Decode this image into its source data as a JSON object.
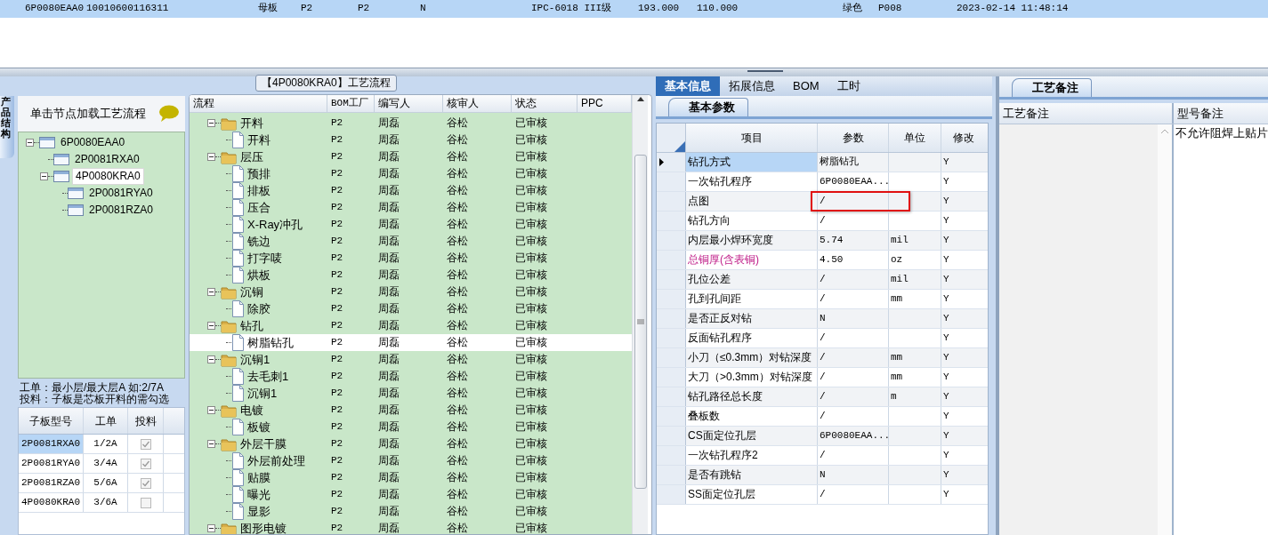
{
  "top_row": {
    "selected": true,
    "cells": [
      "6P0080EAA0",
      "10010600116311",
      "母板",
      "P2",
      "P2",
      "N",
      "IPC-6018 III级",
      "193.000",
      "110.000",
      "绿色",
      "P008",
      "2023-02-14 11:48:14"
    ]
  },
  "left_panel": {
    "side_tab": "产品结构",
    "header": "单击节点加载工艺流程",
    "tree": [
      {
        "label": "6P0080EAA0",
        "expanded": true,
        "selected": false,
        "children": [
          {
            "label": "2P0081RXA0",
            "selected": false
          },
          {
            "label": "4P0080KRA0",
            "expanded": true,
            "selected": true,
            "children": [
              {
                "label": "2P0081RYA0",
                "selected": false
              },
              {
                "label": "2P0081RZA0",
                "selected": false
              }
            ]
          }
        ]
      }
    ],
    "notes": [
      "工单：最小层/最大层A 如:2/7A",
      "投料：子板是芯板开料的需勾选"
    ],
    "table": {
      "columns": [
        "子板型号",
        "工单",
        "投料"
      ],
      "rows": [
        {
          "model": "2P0081RXA0",
          "order": "1/2A",
          "feed": true,
          "selected": true
        },
        {
          "model": "2P0081RYA0",
          "order": "3/4A",
          "feed": true,
          "selected": false
        },
        {
          "model": "2P0081RZA0",
          "order": "5/6A",
          "feed": true,
          "selected": false
        },
        {
          "model": "4P0080KRA0",
          "order": "3/6A",
          "feed": false,
          "selected": false
        }
      ]
    }
  },
  "flow_panel": {
    "title": "【4P0080KRA0】工艺流程",
    "columns": [
      "流程",
      "BOM工厂",
      "编写人",
      "核审人",
      "状态",
      "PPC"
    ],
    "rows": [
      {
        "kind": "folder",
        "name": "开料",
        "factory": "P2",
        "writer": "周磊",
        "reviewer": "谷松",
        "status": "已审核",
        "expanded": true,
        "selected": false,
        "children": [
          {
            "kind": "file",
            "name": "开料",
            "factory": "P2",
            "writer": "周磊",
            "reviewer": "谷松",
            "status": "已审核",
            "selected": false
          }
        ]
      },
      {
        "kind": "folder",
        "name": "层压",
        "factory": "P2",
        "writer": "周磊",
        "reviewer": "谷松",
        "status": "已审核",
        "expanded": true,
        "selected": false,
        "children": [
          {
            "kind": "file",
            "name": "预排",
            "factory": "P2",
            "writer": "周磊",
            "reviewer": "谷松",
            "status": "已审核",
            "selected": false
          },
          {
            "kind": "file",
            "name": "排板",
            "factory": "P2",
            "writer": "周磊",
            "reviewer": "谷松",
            "status": "已审核",
            "selected": false
          },
          {
            "kind": "file",
            "name": "压合",
            "factory": "P2",
            "writer": "周磊",
            "reviewer": "谷松",
            "status": "已审核",
            "selected": false
          },
          {
            "kind": "file",
            "name": "X-Ray冲孔",
            "factory": "P2",
            "writer": "周磊",
            "reviewer": "谷松",
            "status": "已审核",
            "selected": false
          },
          {
            "kind": "file",
            "name": "铣边",
            "factory": "P2",
            "writer": "周磊",
            "reviewer": "谷松",
            "status": "已审核",
            "selected": false
          },
          {
            "kind": "file",
            "name": "打字唛",
            "factory": "P2",
            "writer": "周磊",
            "reviewer": "谷松",
            "status": "已审核",
            "selected": false
          },
          {
            "kind": "file",
            "name": "烘板",
            "factory": "P2",
            "writer": "周磊",
            "reviewer": "谷松",
            "status": "已审核",
            "selected": false
          }
        ]
      },
      {
        "kind": "folder",
        "name": "沉铜",
        "factory": "P2",
        "writer": "周磊",
        "reviewer": "谷松",
        "status": "已审核",
        "expanded": true,
        "selected": false,
        "children": [
          {
            "kind": "file",
            "name": "除胶",
            "factory": "P2",
            "writer": "周磊",
            "reviewer": "谷松",
            "status": "已审核",
            "selected": false
          }
        ]
      },
      {
        "kind": "folder",
        "name": "钻孔",
        "factory": "P2",
        "writer": "周磊",
        "reviewer": "谷松",
        "status": "已审核",
        "expanded": true,
        "selected": false,
        "children": [
          {
            "kind": "file",
            "name": "树脂钻孔",
            "factory": "P2",
            "writer": "周磊",
            "reviewer": "谷松",
            "status": "已审核",
            "selected": true
          }
        ]
      },
      {
        "kind": "folder",
        "name": "沉铜1",
        "factory": "P2",
        "writer": "周磊",
        "reviewer": "谷松",
        "status": "已审核",
        "expanded": true,
        "selected": false,
        "children": [
          {
            "kind": "file",
            "name": "去毛刺1",
            "factory": "P2",
            "writer": "周磊",
            "reviewer": "谷松",
            "status": "已审核",
            "selected": false
          },
          {
            "kind": "file",
            "name": "沉铜1",
            "factory": "P2",
            "writer": "周磊",
            "reviewer": "谷松",
            "status": "已审核",
            "selected": false
          }
        ]
      },
      {
        "kind": "folder",
        "name": "电镀",
        "factory": "P2",
        "writer": "周磊",
        "reviewer": "谷松",
        "status": "已审核",
        "expanded": true,
        "selected": false,
        "children": [
          {
            "kind": "file",
            "name": "板镀",
            "factory": "P2",
            "writer": "周磊",
            "reviewer": "谷松",
            "status": "已审核",
            "selected": false
          }
        ]
      },
      {
        "kind": "folder",
        "name": "外层干膜",
        "factory": "P2",
        "writer": "周磊",
        "reviewer": "谷松",
        "status": "已审核",
        "expanded": true,
        "selected": false,
        "children": [
          {
            "kind": "file",
            "name": "外层前处理",
            "factory": "P2",
            "writer": "周磊",
            "reviewer": "谷松",
            "status": "已审核",
            "selected": false
          },
          {
            "kind": "file",
            "name": "贴膜",
            "factory": "P2",
            "writer": "周磊",
            "reviewer": "谷松",
            "status": "已审核",
            "selected": false
          },
          {
            "kind": "file",
            "name": "曝光",
            "factory": "P2",
            "writer": "周磊",
            "reviewer": "谷松",
            "status": "已审核",
            "selected": false
          },
          {
            "kind": "file",
            "name": "显影",
            "factory": "P2",
            "writer": "周磊",
            "reviewer": "谷松",
            "status": "已审核",
            "selected": false
          }
        ]
      },
      {
        "kind": "folder",
        "name": "图形电镀",
        "factory": "P2",
        "writer": "周磊",
        "reviewer": "谷松",
        "status": "已审核",
        "expanded": true,
        "selected": false
      }
    ]
  },
  "info_panel": {
    "tabs": [
      {
        "label": "基本信息",
        "selected": true
      },
      {
        "label": "拓展信息",
        "selected": false
      },
      {
        "label": "BOM",
        "selected": false
      },
      {
        "label": "工时",
        "selected": false
      }
    ],
    "subtab": "基本参数",
    "columns": [
      "项目",
      "参数",
      "单位",
      "修改"
    ],
    "rows": [
      {
        "item": "钻孔方式",
        "value": "树脂钻孔",
        "modify": "Y",
        "selected": true,
        "emphasized": false,
        "marked": false
      },
      {
        "item": "一次钻孔程序",
        "value": "6P0080EAA...",
        "modify": "Y",
        "selected": false,
        "emphasized": false,
        "marked": false
      },
      {
        "item": "点图",
        "value": "/",
        "modify": "Y",
        "selected": false,
        "emphasized": false,
        "marked": true
      },
      {
        "item": "钻孔方向",
        "value": "/",
        "modify": "Y",
        "selected": false,
        "emphasized": false,
        "marked": false
      },
      {
        "item": "内层最小焊环宽度",
        "value": "5.74",
        "unit": "mil",
        "modify": "Y",
        "selected": false,
        "emphasized": false,
        "marked": false
      },
      {
        "item": "总铜厚(含表铜)",
        "value": "4.50",
        "unit": "oz",
        "modify": "Y",
        "selected": false,
        "emphasized": true,
        "marked": false
      },
      {
        "item": "孔位公差",
        "value": "/",
        "unit": "mil",
        "modify": "Y",
        "selected": false,
        "emphasized": false,
        "marked": false
      },
      {
        "item": "孔到孔间距",
        "value": "/",
        "unit": "mm",
        "modify": "Y",
        "selected": false,
        "emphasized": false,
        "marked": false
      },
      {
        "item": "是否正反对钻",
        "value": "N",
        "modify": "Y",
        "selected": false,
        "emphasized": false,
        "marked": false
      },
      {
        "item": "反面钻孔程序",
        "value": "/",
        "modify": "Y",
        "selected": false,
        "emphasized": false,
        "marked": false
      },
      {
        "item": "小刀（≤0.3mm）对钻深度",
        "value": "/",
        "unit": "mm",
        "modify": "Y",
        "selected": false,
        "emphasized": false,
        "marked": false
      },
      {
        "item": "大刀（>0.3mm）对钻深度",
        "value": "/",
        "unit": "mm",
        "modify": "Y",
        "selected": false,
        "emphasized": false,
        "marked": false
      },
      {
        "item": "钻孔路径总长度",
        "value": "/",
        "unit": "m",
        "modify": "Y",
        "selected": false,
        "emphasized": false,
        "marked": false
      },
      {
        "item": "叠板数",
        "value": "/",
        "modify": "Y",
        "selected": false,
        "emphasized": false,
        "marked": false
      },
      {
        "item": "CS面定位孔层",
        "value": "6P0080EAA...",
        "modify": "Y",
        "selected": false,
        "emphasized": false,
        "marked": false
      },
      {
        "item": "一次钻孔程序2",
        "value": "/",
        "modify": "Y",
        "selected": false,
        "emphasized": false,
        "marked": false
      },
      {
        "item": "是否有跳钻",
        "value": "N",
        "modify": "Y",
        "selected": false,
        "emphasized": false,
        "marked": false
      },
      {
        "item": "SS面定位孔层",
        "value": "/",
        "modify": "Y",
        "selected": false,
        "emphasized": false,
        "marked": false
      }
    ]
  },
  "remarks_panel": {
    "subtab": "工艺备注",
    "columns": [
      "工艺备注",
      "型号备注"
    ],
    "model_remark": "不允许阻焊上贴片"
  }
}
